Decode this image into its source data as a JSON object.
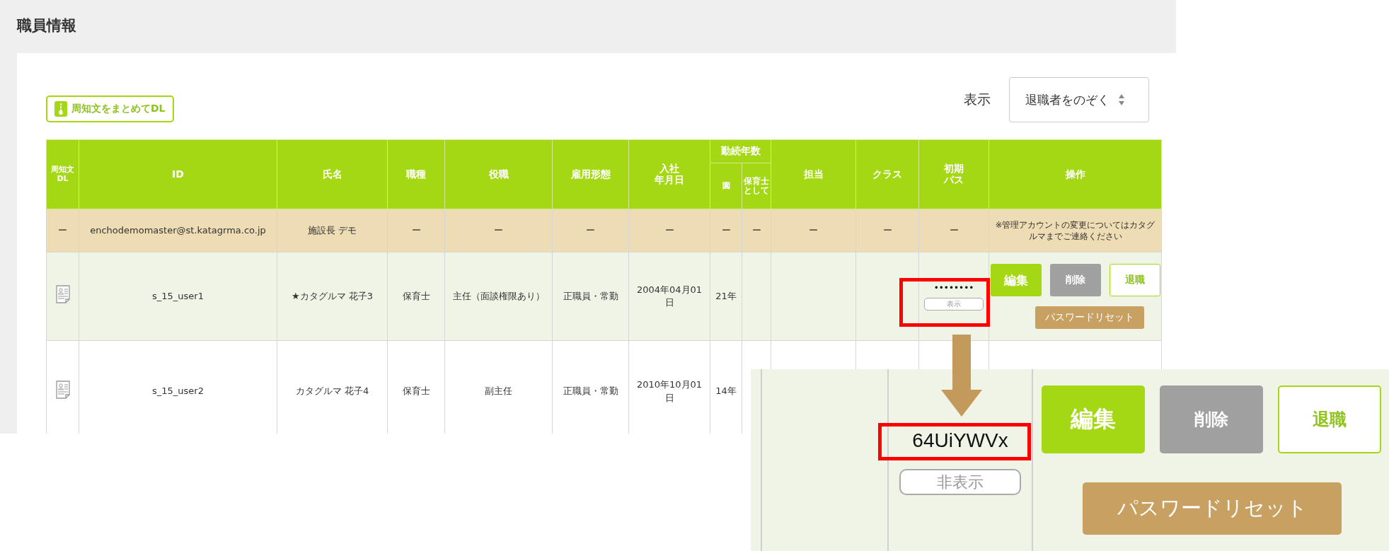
{
  "title": "職員情報",
  "download_button": "周知文をまとめてDL",
  "filter": {
    "label": "表示",
    "value": "退職者をのぞく"
  },
  "table": {
    "header_rows": [
      [
        {
          "lines": [
            "周知文",
            "DL"
          ],
          "rowspan": 2
        },
        {
          "lines": [
            "ID"
          ],
          "rowspan": 2
        },
        {
          "lines": [
            "氏名"
          ],
          "rowspan": 2
        },
        {
          "lines": [
            "職種"
          ],
          "rowspan": 2
        },
        {
          "lines": [
            "役職"
          ],
          "rowspan": 2
        },
        {
          "lines": [
            "雇用形態"
          ],
          "rowspan": 2
        },
        {
          "lines": [
            "入社",
            "年月日"
          ],
          "rowspan": 2
        },
        {
          "lines": [
            "勤続年数"
          ],
          "colspan": 2
        },
        {
          "lines": [
            "担当"
          ],
          "rowspan": 2
        },
        {
          "lines": [
            "クラス"
          ],
          "rowspan": 2
        },
        {
          "lines": [
            "初期",
            "パス"
          ],
          "rowspan": 2
        },
        {
          "lines": [
            "操作"
          ],
          "rowspan": 2
        }
      ],
      [
        {
          "lines": [
            "園"
          ]
        },
        {
          "lines": [
            "保育士として"
          ]
        }
      ]
    ],
    "rows": [
      {
        "kind": "admin",
        "cells": [
          "ー",
          "enchodemomaster@st.katagrma.co.jp",
          "施設長 デモ",
          "ー",
          "ー",
          "ー",
          "ー",
          "ー",
          "ー",
          "ー",
          "ー",
          "ー"
        ],
        "note": "※管理アカウントの変更についてはカタグルマまでご連絡ください"
      },
      {
        "kind": "user",
        "cells": [
          "",
          "s_15_user1",
          "★カタグルマ 花子3",
          "保育士",
          "主任（面談権限あり）",
          "正職員・常勤",
          "2004年04月01日",
          "21年",
          "",
          "",
          ""
        ],
        "password": "••••••••",
        "show_button": "表示",
        "buttons": [
          "編集",
          "削除",
          "退職"
        ],
        "reset_button": "パスワードリセット"
      },
      {
        "kind": "user",
        "cells": [
          "",
          "s_15_user2",
          "カタグルマ 花子4",
          "保育士",
          "副主任",
          "正職員・常勤",
          "2010年10月01日",
          "14年",
          "",
          "",
          ""
        ]
      }
    ]
  },
  "inset": {
    "password": "64UiYWVx",
    "hide_button": "非表示",
    "buttons": [
      "編集",
      "削除",
      "退職"
    ],
    "reset_button": "パスワードリセット"
  }
}
